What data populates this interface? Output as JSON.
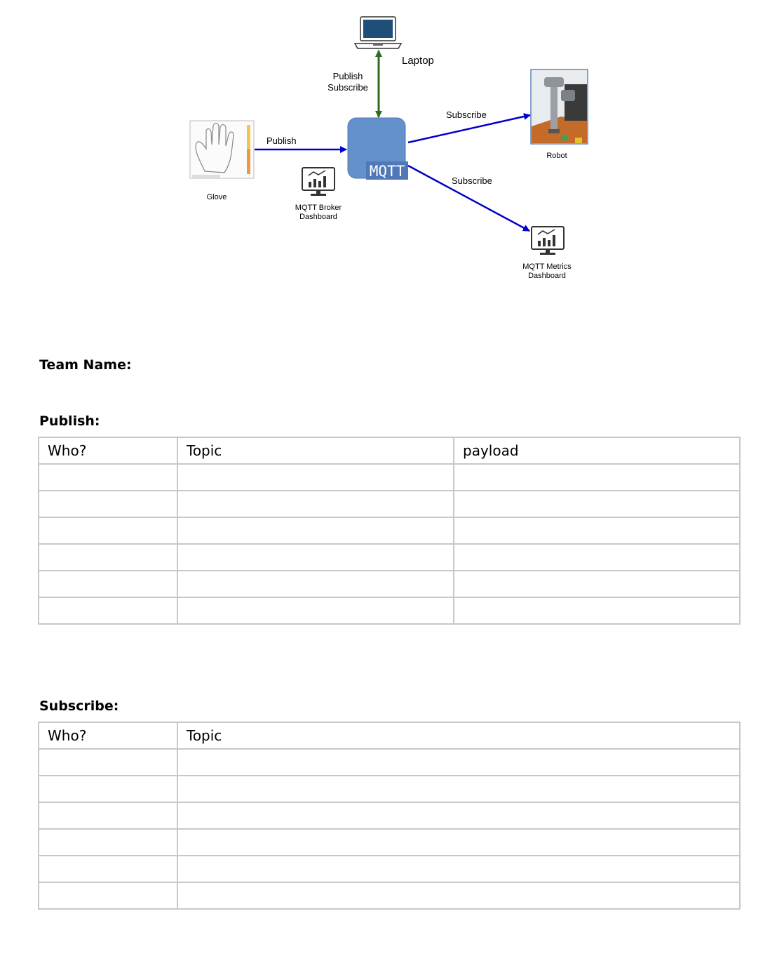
{
  "diagram": {
    "laptop_label": "Laptop",
    "laptop_link_label_1": "Publish",
    "laptop_link_label_2": "Subscribe",
    "robot_link_label": "Subscribe",
    "robot_label": "Robot",
    "glove_link_label": "Publish",
    "glove_label": "Glove",
    "broker_badge": "MQTT",
    "broker_dashboard_label_1": "MQTT Broker",
    "broker_dashboard_label_2": "Dashboard",
    "metrics_link_label": "Subscribe",
    "metrics_dashboard_label_1": "MQTT Metrics",
    "metrics_dashboard_label_2": "Dashboard",
    "colors": {
      "blue_arrow": "#0000cc",
      "green_arrow": "#2e6b1f",
      "broker": "#6491cc",
      "laptop_screen": "#1f4e79"
    }
  },
  "team_name_label": "Team Name:",
  "publish": {
    "heading": "Publish:",
    "columns": [
      "Who?",
      "Topic",
      "payload"
    ],
    "rows": [
      [
        "",
        "",
        ""
      ],
      [
        "",
        "",
        ""
      ],
      [
        "",
        "",
        ""
      ],
      [
        "",
        "",
        ""
      ],
      [
        "",
        "",
        ""
      ],
      [
        "",
        "",
        ""
      ]
    ]
  },
  "subscribe": {
    "heading": "Subscribe:",
    "columns": [
      "Who?",
      "Topic"
    ],
    "rows": [
      [
        "",
        ""
      ],
      [
        "",
        ""
      ],
      [
        "",
        ""
      ],
      [
        "",
        ""
      ],
      [
        "",
        ""
      ],
      [
        "",
        ""
      ]
    ]
  }
}
